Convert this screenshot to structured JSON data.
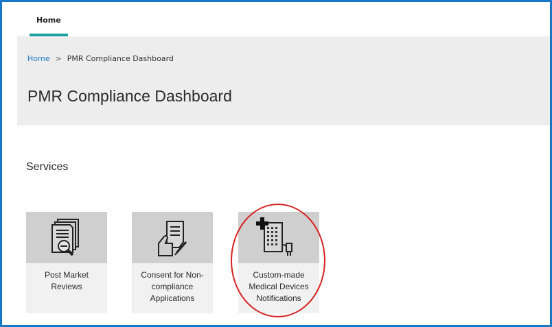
{
  "topnav": {
    "home_label": "Home"
  },
  "breadcrumb": {
    "home": "Home",
    "separator": ">",
    "current": "PMR Compliance Dashboard"
  },
  "page": {
    "title": "PMR Compliance Dashboard"
  },
  "services": {
    "heading": "Services",
    "tiles": [
      {
        "icon": "document-search-icon",
        "line1": "Post Market",
        "line2": "Reviews",
        "line3": ""
      },
      {
        "icon": "hand-document-pen-icon",
        "line1": "Consent for Non-",
        "line2": "compliance",
        "line3": "Applications"
      },
      {
        "icon": "medical-device-icon",
        "line1": "Custom-made",
        "line2": "Medical Devices",
        "line3": "Notifications"
      }
    ]
  },
  "colors": {
    "frame_border": "#1577c7",
    "nav_underline": "#1aa0a0",
    "link": "#1a77c4",
    "highlight": "#d62020"
  }
}
